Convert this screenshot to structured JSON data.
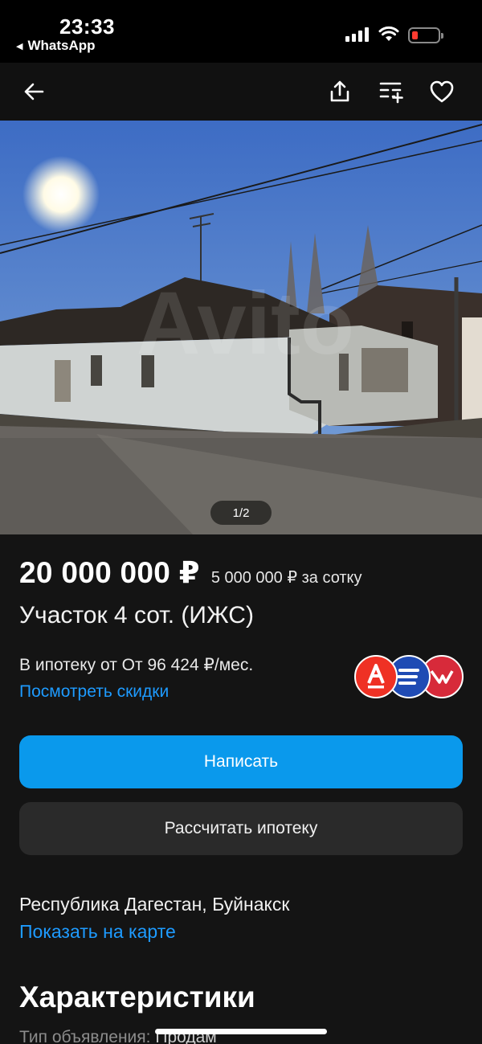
{
  "status_bar": {
    "time": "23:33",
    "back_app": "WhatsApp",
    "battery_color": "#ff3b30"
  },
  "app_bar": {
    "icons": [
      "back-arrow-icon",
      "share-icon",
      "compare-icon",
      "heart-icon"
    ]
  },
  "gallery": {
    "counter": "1/2",
    "watermark": "Avito"
  },
  "listing": {
    "price": "20 000 000 ₽",
    "price_per": "5 000 000 ₽ за сотку",
    "title": "Участок 4 сот. (ИЖС)",
    "mortgage": "В ипотеку от От 96 424 ₽/мес.",
    "discounts_link": "Посмотреть скидки",
    "banks": [
      "alfa-bank-logo",
      "bank-logo-2",
      "bank-logo-3"
    ]
  },
  "actions": {
    "write": "Написать",
    "calc_mortgage": "Рассчитать ипотеку"
  },
  "location": {
    "address": "Республика Дагестан, Буйнакск",
    "map_link": "Показать на карте"
  },
  "characteristics": {
    "title": "Характеристики",
    "rows": [
      {
        "label": "Тип объявления:",
        "value": "Продам"
      }
    ]
  },
  "colors": {
    "accent": "#0a99ec",
    "link": "#1e9bff",
    "background": "#141414"
  }
}
